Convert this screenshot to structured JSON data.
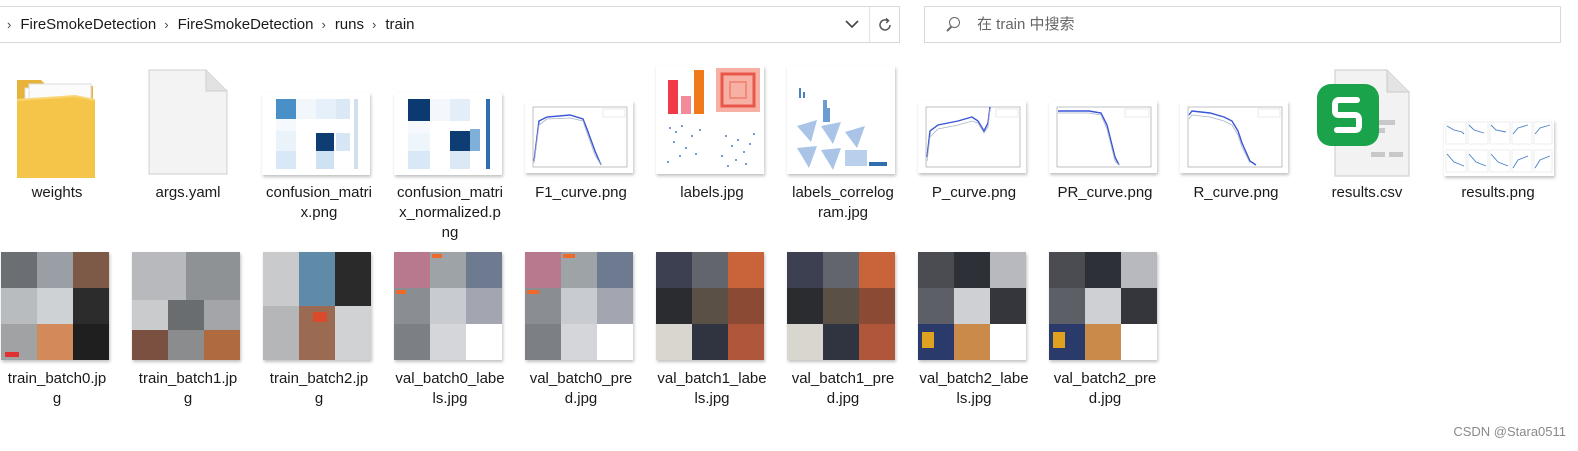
{
  "breadcrumbs": [
    "FireSmokeDetection",
    "FireSmokeDetection",
    "runs",
    "train"
  ],
  "search": {
    "placeholder": "在 train 中搜索"
  },
  "icons": {
    "separator": "chevron-right-icon",
    "dropdown": "chevron-down-icon",
    "refresh": "refresh-icon",
    "search": "search-icon"
  },
  "files_row1": [
    {
      "name": "weights",
      "kind": "folder"
    },
    {
      "name": "args.yaml",
      "kind": "document"
    },
    {
      "name": "confusion_matrix.png",
      "kind": "image"
    },
    {
      "name": "confusion_matrix_normalized.png",
      "kind": "image"
    },
    {
      "name": "F1_curve.png",
      "kind": "image"
    },
    {
      "name": "labels.jpg",
      "kind": "image"
    },
    {
      "name": "labels_correlogram.jpg",
      "kind": "image"
    },
    {
      "name": "P_curve.png",
      "kind": "image"
    },
    {
      "name": "PR_curve.png",
      "kind": "image"
    },
    {
      "name": "R_curve.png",
      "kind": "image"
    },
    {
      "name": "results.csv",
      "kind": "spreadsheet"
    },
    {
      "name": "results.png",
      "kind": "image"
    }
  ],
  "files_row2": [
    {
      "name": "train_batch0.jpg",
      "kind": "image"
    },
    {
      "name": "train_batch1.jpg",
      "kind": "image"
    },
    {
      "name": "train_batch2.jpg",
      "kind": "image"
    },
    {
      "name": "val_batch0_labels.jpg",
      "kind": "image"
    },
    {
      "name": "val_batch0_pred.jpg",
      "kind": "image"
    },
    {
      "name": "val_batch1_labels.jpg",
      "kind": "image"
    },
    {
      "name": "val_batch1_pred.jpg",
      "kind": "image"
    },
    {
      "name": "val_batch2_labels.jpg",
      "kind": "image"
    },
    {
      "name": "val_batch2_pred.jpg",
      "kind": "image"
    }
  ],
  "labels": {
    "weights": [
      "weights"
    ],
    "args": [
      "args.yaml"
    ],
    "confusion_matrix": [
      "confusion_matri",
      "x.png"
    ],
    "confusion_matrix_normalized": [
      "confusion_matri",
      "x_normalized.p",
      "ng"
    ],
    "f1": [
      "F1_curve.png"
    ],
    "labels_jpg": [
      "labels.jpg"
    ],
    "labels_correlogram": [
      "labels_correlog",
      "ram.jpg"
    ],
    "p_curve": [
      "P_curve.png"
    ],
    "pr_curve": [
      "PR_curve.png"
    ],
    "r_curve": [
      "R_curve.png"
    ],
    "results_csv": [
      "results.csv"
    ],
    "results_png": [
      "results.png"
    ],
    "train0": [
      "train_batch0.jp",
      "g"
    ],
    "train1": [
      "train_batch1.jp",
      "g"
    ],
    "train2": [
      "train_batch2.jp",
      "g"
    ],
    "val0l": [
      "val_batch0_labe",
      "ls.jpg"
    ],
    "val0p": [
      "val_batch0_pre",
      "d.jpg"
    ],
    "val1l": [
      "val_batch1_labe",
      "ls.jpg"
    ],
    "val1p": [
      "val_batch1_pre",
      "d.jpg"
    ],
    "val2l": [
      "val_batch2_labe",
      "ls.jpg"
    ],
    "val2p": [
      "val_batch2_pre",
      "d.jpg"
    ]
  },
  "watermark": "CSDN @Stara0511",
  "colors": {
    "csv_green": "#1aa34a",
    "folder_yellow": "#f5c54a",
    "heat_blue": "#1a4f8a"
  }
}
